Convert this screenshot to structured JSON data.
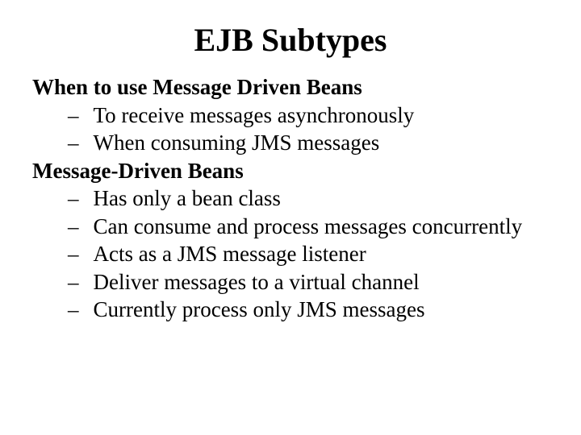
{
  "title": "EJB Subtypes",
  "sections": [
    {
      "heading": "When to use Message Driven Beans",
      "bullets": [
        "To receive messages asynchronously",
        "When consuming JMS messages"
      ]
    },
    {
      "heading": "Message-Driven Beans",
      "bullets": [
        "Has only a bean class",
        "Can consume and process messages concurrently",
        "Acts as a JMS message listener",
        "Deliver messages to a virtual channel",
        "Currently process only JMS messages"
      ]
    }
  ]
}
